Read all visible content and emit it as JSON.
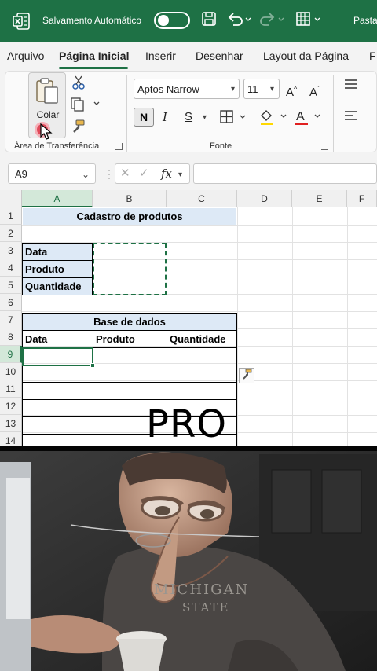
{
  "titlebar": {
    "autosave_label": "Salvamento Automático",
    "file_name": "Pasta",
    "icons": [
      "excel-logo-icon",
      "autosave-toggle",
      "save-icon",
      "undo-icon",
      "redo-icon",
      "table-icon"
    ],
    "color": "#1e7145"
  },
  "menu": {
    "tabs": [
      "Arquivo",
      "Página Inicial",
      "Inserir",
      "Desenhar",
      "Layout da Página",
      "F"
    ],
    "active": "Página Inicial"
  },
  "ribbon": {
    "clipboard_group": {
      "label": "Área de Transferência",
      "paste_label": "Colar",
      "icons": [
        "clipboard-icon",
        "scissors-icon",
        "copy-icon",
        "format-painter-icon"
      ]
    },
    "font_group": {
      "label": "Fonte",
      "font_name": "Aptos Narrow",
      "font_size": "11",
      "buttons": [
        "N",
        "I",
        "S"
      ],
      "icons": [
        "increase-font-icon",
        "decrease-font-icon",
        "borders-icon",
        "fill-color-icon",
        "font-color-icon"
      ]
    }
  },
  "formula_bar": {
    "name_box": "A9",
    "fx_label": "fx",
    "value": ""
  },
  "sheet": {
    "columns": [
      "A",
      "B",
      "C",
      "D",
      "E",
      "F"
    ],
    "selected_column": "A",
    "rows": [
      "1",
      "2",
      "3",
      "4",
      "5",
      "6",
      "7",
      "8",
      "9",
      "10",
      "11",
      "12",
      "13",
      "14"
    ],
    "selected_row": "9",
    "active_cell": "A9",
    "title_cell": "Cadastro de produtos",
    "form_labels": [
      "Data",
      "Produto",
      "Quantidade"
    ],
    "db_title": "Base de dados",
    "db_headers": [
      "Data",
      "Produto",
      "Quantidade"
    ],
    "header_fill": "#dde9f6"
  },
  "overlay": {
    "caption": "PRO"
  },
  "meme": {
    "shirt_lines": [
      "MICHIGAN",
      "STATE"
    ]
  }
}
